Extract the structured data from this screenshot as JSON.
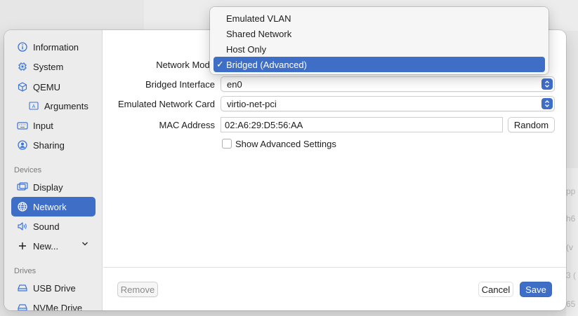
{
  "sidebar": {
    "items": [
      {
        "label": "Information",
        "icon": "info-icon"
      },
      {
        "label": "System",
        "icon": "chip-icon"
      },
      {
        "label": "QEMU",
        "icon": "cube-icon"
      },
      {
        "label": "Arguments",
        "icon": "text-field-icon"
      },
      {
        "label": "Input",
        "icon": "keyboard-icon"
      },
      {
        "label": "Sharing",
        "icon": "person-icon"
      }
    ],
    "devices_heading": "Devices",
    "device_items": [
      {
        "label": "Display",
        "icon": "display-icon"
      },
      {
        "label": "Network",
        "icon": "globe-icon",
        "selected": true
      },
      {
        "label": "Sound",
        "icon": "speaker-icon"
      }
    ],
    "new_label": "New...",
    "drives_heading": "Drives",
    "drive_items": [
      {
        "label": "USB Drive",
        "icon": "drive-icon"
      },
      {
        "label": "NVMe Drive",
        "icon": "drive-icon"
      }
    ]
  },
  "form": {
    "network_mode_label": "Network Mode",
    "bridged_interface_label": "Bridged Interface",
    "bridged_interface_value": "en0",
    "network_card_label": "Emulated Network Card",
    "network_card_value": "virtio-net-pci",
    "mac_label": "MAC Address",
    "mac_value": "02:A6:29:D5:56:AA",
    "random_label": "Random",
    "advanced_label": "Show Advanced Settings"
  },
  "footer": {
    "remove_label": "Remove",
    "cancel_label": "Cancel",
    "save_label": "Save"
  },
  "network_mode_menu": {
    "options": [
      "Emulated VLAN",
      "Shared Network",
      "Host Only",
      "Bridged (Advanced)"
    ],
    "selected": "Bridged (Advanced)",
    "check_glyph": "✓"
  },
  "background": {
    "fragments": [
      "pp",
      "h6",
      "(v",
      "3 (",
      "65"
    ]
  },
  "colors": {
    "accent": "#3f6ec7"
  }
}
